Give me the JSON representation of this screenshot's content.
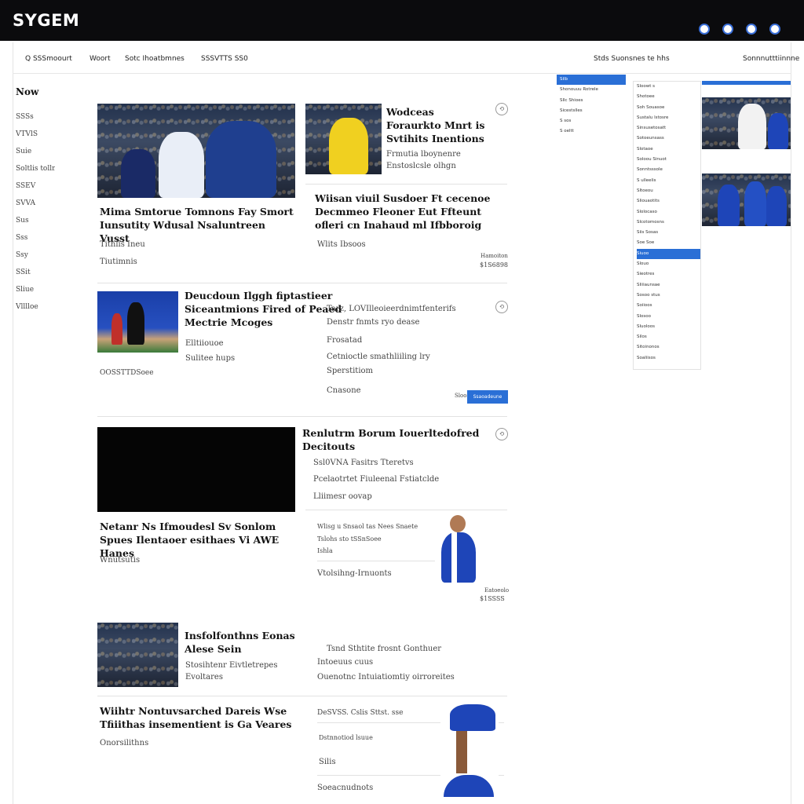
{
  "brand": "SYGEM",
  "top_icons": [
    "globe-icon",
    "user-icon",
    "bell-icon",
    "settings-icon"
  ],
  "subnav": [
    "Q SSSmoourt",
    "Woort",
    "Sotc Ihoatbmnes",
    "SSSVTTS SS0",
    "Stds Suonsnes te hhs",
    "Sonnnutttiinnne"
  ],
  "left_nav": {
    "now": "Now",
    "items": [
      "SSSs",
      "VTVlS",
      "Suie",
      "Soltlis tolln",
      "SSEV",
      "SVVA",
      "Sus",
      "Sss",
      "Ssy",
      "SSit",
      "Sliue",
      "Vlllloe"
    ]
  },
  "cards": {
    "c1": {
      "title": "Mima Smtorue Tomnons Fay Smort Iunsutity Wdusal Nsaluntreen Vusst",
      "m1": "Tithlis Ineu",
      "m2": "Tiutimnis"
    },
    "c2": {
      "title": "Wodceas Foraurkto Mnrt is Svtihits Inentions",
      "m1": "Frmutia lboynenre",
      "m2": "Enstoslcsle olhgn"
    },
    "c3": {
      "title": "Wiisan viuil Susdoer Ft cecenoe Decmmeo Fleoner Eut Ffteunt ofleri cn Inahaud ml Ifbboroig",
      "m1": "Wlits Ibsoos",
      "time_label": "Hamoiton",
      "time": "$1S6898"
    },
    "c4": {
      "title": "Deucdoun Ilggh fiptastieer Siceantmions Fired of Peaed Mectrie Mcoges",
      "m1": "Elltiiouoe",
      "m2": "Sulitee hups",
      "code": "OOSSTTDSoee"
    },
    "c5": {
      "m1": "Tarz, LOVIlleoieerdnimtfenterifs",
      "m2": "Denstr fnmts ryo dease",
      "m3": "Frosatad",
      "m4": "Cetnioctle smathliiling lry",
      "m5": "Sperstitiom",
      "m6": "Cnasone",
      "btn_label": "Sloos",
      "btn2": "Ssaoadeune"
    },
    "c6": {
      "title": "Renlutrm Borum Iouerltedofred Decitouts",
      "m1": "Ssl0VNA Fasitrs Tteretvs",
      "m2": "Pcelaotrtet Fiuleenal Fstiatclde",
      "m3": "Lliimesr oovap"
    },
    "c7": {
      "title": "Netanr Ns Ifmoudesl Sv Sonlom Spues Ilentaoer esithaes Vi AWE Hanes",
      "m1": "Wnutsutis"
    },
    "c8": {
      "m1": "Wlisg u Snsaol tas Nees Snaete",
      "m2": "Tslohs sto tSSnSoee",
      "m3": "Ishla",
      "m4": "Vtolsihng-Irnuonts",
      "time_label": "Eatoeolo",
      "time": "$1SSSS"
    },
    "c9": {
      "title": "Insfolfonthns Eonas Alese Sein",
      "m1": "Stosihtenr Eivtletrepes",
      "m2": "Evoltares",
      "m3": "Tsnd Sthtite frosnt Gonthuer",
      "m4": "Intoeuus cuus",
      "m5": "Ouenotnc Intuiatiomtiy oirroreites"
    },
    "c10": {
      "title": "Wiihtr Nontuvsarched Dareis Wse Tfiiithas insementient is Ga Veares",
      "m1": "Onorsilithns",
      "m2": "DeSVSS. Cslis Sttst. sse",
      "m3": "Dstnnotiod lsuue",
      "m4": "Silis",
      "m5": "Soeacnudnots"
    }
  },
  "right_panel": {
    "left_col": [
      "Silb",
      "Shonouuu Rotrele",
      "Sllc Shioes",
      "Sicestslles",
      "S sos",
      "S oeltt"
    ],
    "mid_col": [
      "Sloowt s",
      "Shotoee",
      "Soh Souasoe",
      "Sustalu lstosre",
      "Sinsusetosatt",
      "Sotoeunsass",
      "Slotaoe",
      "Soloou Sinuot",
      "Sonntsssole",
      "S ulleelis",
      "Sltoeou",
      "Sliouaotits",
      "Slolocaso",
      "Slcotomosns",
      "Siis Sosas",
      "Soe Soe",
      "Slouo",
      "Sieotres",
      "Sliiiaunsae",
      "Sosoo stus",
      "Soiioos",
      "Slosoo",
      "Sluoloos",
      "Silos",
      "Sitoinonos",
      "Soaliisos"
    ],
    "mid_col_highlight": "Siuoo",
    "color_accent": "#2a6fd6"
  }
}
